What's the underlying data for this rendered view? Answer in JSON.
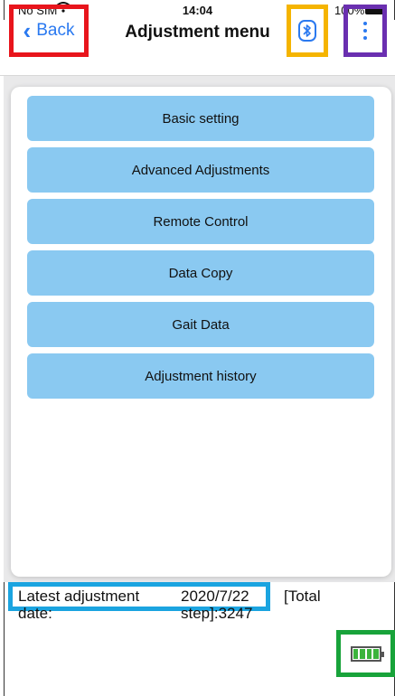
{
  "status_bar": {
    "carrier": "No SIM",
    "time": "14:04",
    "battery_percent": "100%"
  },
  "nav": {
    "back_label": "Back",
    "title": "Adjustment menu",
    "bluetooth_icon": "bluetooth-icon",
    "more_icon": "more-vertical-icon"
  },
  "menu": {
    "items": [
      "Basic setting",
      "Advanced Adjustments",
      "Remote Control",
      "Data Copy",
      "Gait Data",
      "Adjustment history"
    ]
  },
  "footer": {
    "latest_label_line1": "Latest adjustment",
    "latest_label_line2": "date:",
    "latest_date": "2020/7/22",
    "total_step_line1": "[Total",
    "total_step_line2": "step]:3247",
    "device_battery_icon": "battery-full-icon",
    "device_battery_level": 1.0
  },
  "colors": {
    "accent": "#2a79f0",
    "menu_button": "#8ac9f1",
    "highlight_back": "#e8151c",
    "highlight_bluetooth": "#f5b400",
    "highlight_more": "#6a2fb0",
    "highlight_latest": "#1ba4e0",
    "highlight_battery": "#18a33a"
  }
}
